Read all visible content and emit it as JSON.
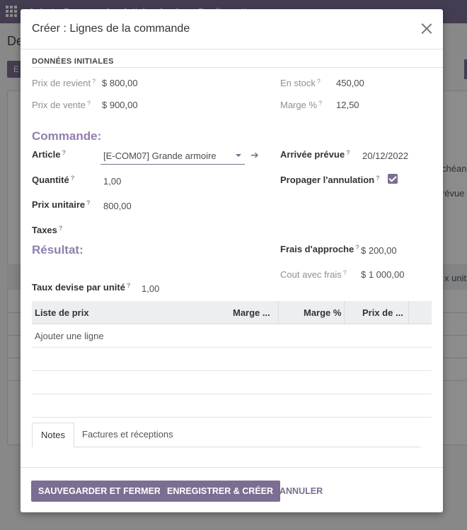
{
  "background": {
    "menu_text": "Achats   Commandes   Articles   Analyse   Configuration",
    "breadcrumb": "De",
    "button_short": "E",
    "side_text_1": "chéanc",
    "side_text_2": "révue",
    "side_text_3": "x unit..."
  },
  "dialog": {
    "title": "Créer : Lignes de la commande",
    "close_icon": "close-icon"
  },
  "initial_data": {
    "section_title": "DONNÉES INITIALES",
    "cost_price_label": "Prix de revient",
    "cost_price_value": "$ 800,00",
    "sale_price_label": "Prix de vente",
    "sale_price_value": "$ 900,00",
    "stock_label": "En stock",
    "stock_value": "450,00",
    "margin_label": "Marge %",
    "margin_value": "12,50"
  },
  "order": {
    "group_title": "Commande:",
    "article_label": "Article",
    "article_value": "[E-COM07] Grande armoire",
    "quantity_label": "Quantité",
    "quantity_value": "1,00",
    "unit_price_label": "Prix unitaire",
    "unit_price_value": "800,00",
    "taxes_label": "Taxes",
    "expected_arrival_label": "Arrivée prévue",
    "expected_arrival_value": "20/12/2022",
    "propagate_cancel_label": "Propager l'annulation",
    "propagate_cancel_checked": true
  },
  "result": {
    "group_title": "Résultat:",
    "approach_costs_label": "Frais d'approche",
    "approach_costs_value": "$ 200,00",
    "cost_with_fees_label": "Cout avec frais",
    "cost_with_fees_value": "$ 1 000,00",
    "currency_rate_label": "Taux devise par unité",
    "currency_rate_value": "1,00"
  },
  "price_list": {
    "columns": [
      "Liste de prix",
      "Marge ...",
      "Marge %",
      "Prix de ..."
    ],
    "add_line": "Ajouter une ligne"
  },
  "tabs": {
    "notes": "Notes",
    "invoices": "Factures et réceptions"
  },
  "footer": {
    "save_close": "SAUVEGARDER ET FERMER",
    "save_new": "ENREGISTRER & CRÉER",
    "cancel": "ANNULER"
  },
  "help_marker": "?",
  "colors": {
    "accent": "#7c6e92",
    "group_title": "#8f7fae"
  }
}
